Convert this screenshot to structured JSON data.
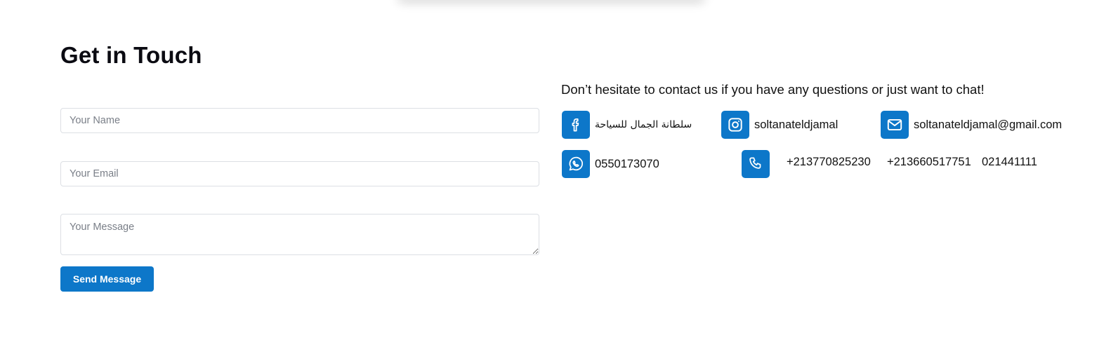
{
  "form": {
    "title": "Get in Touch",
    "name_placeholder": "Your Name",
    "email_placeholder": "Your Email",
    "message_placeholder": "Your Message",
    "send_label": "Send Message"
  },
  "contact": {
    "intro": "Don’t hesitate to contact us if you have any questions or just want to chat!",
    "facebook": {
      "icon": "facebook-icon",
      "label": "سلطانة الجمال للسياحة"
    },
    "instagram": {
      "icon": "instagram-icon",
      "label": "soltanateldjamal"
    },
    "email": {
      "icon": "mail-icon",
      "label": "soltanateldjamal@gmail.com"
    },
    "whatsapp": {
      "icon": "whatsapp-icon",
      "label": "0550173070"
    },
    "phone": {
      "icon": "phone-icon",
      "numbers": [
        "+213770825230",
        "+213660517751",
        "021441111"
      ]
    }
  },
  "colors": {
    "accent": "#0d77c9",
    "text": "#111111",
    "border": "#dcdfe4"
  }
}
